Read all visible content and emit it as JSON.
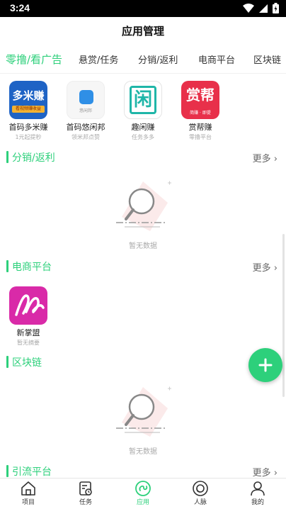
{
  "status_bar": {
    "time": "3:24"
  },
  "header": {
    "title": "应用管理"
  },
  "tabs": [
    {
      "label": "零撸/看广告",
      "active": true
    },
    {
      "label": "悬赏/任务",
      "active": false
    },
    {
      "label": "分销/返利",
      "active": false
    },
    {
      "label": "电商平台",
      "active": false
    },
    {
      "label": "区块链",
      "active": false
    }
  ],
  "top_apps": [
    {
      "name": "首码多米赚",
      "desc": "1元起提秒",
      "icon_text": "多米赚",
      "icon_sub": "看视频赚收益"
    },
    {
      "name": "首码悠闲邦",
      "desc": "领米邦点赞",
      "icon_text": "悠闲邦"
    },
    {
      "name": "趣闲赚",
      "desc": "任务多多",
      "icon_text": "闲"
    },
    {
      "name": "赏帮赚",
      "desc": "零撸平台",
      "icon_text": "赏帮",
      "icon_sub": "简赚 · 即提"
    }
  ],
  "sections": {
    "distribution": {
      "title": "分销/返利",
      "more": "更多 ›",
      "empty_text": "暂无数据"
    },
    "ecommerce": {
      "title": "电商平台",
      "more": "更多 ›"
    },
    "blockchain": {
      "title": "区块链",
      "empty_text": "暂无数据"
    },
    "traffic": {
      "title": "引流平台",
      "more": "更多 ›"
    }
  },
  "ecommerce_apps": [
    {
      "name": "新掌盟",
      "desc": "暂无摘要"
    }
  ],
  "bottom_nav": [
    {
      "label": "项目",
      "icon": "home-icon",
      "active": false
    },
    {
      "label": "任务",
      "icon": "task-icon",
      "active": false
    },
    {
      "label": "应用",
      "icon": "apps-icon",
      "active": true
    },
    {
      "label": "人脉",
      "icon": "network-icon",
      "active": false
    },
    {
      "label": "我的",
      "icon": "profile-icon",
      "active": false
    }
  ],
  "colors": {
    "accent": "#2dd07b",
    "fab": "#2dd07b"
  }
}
